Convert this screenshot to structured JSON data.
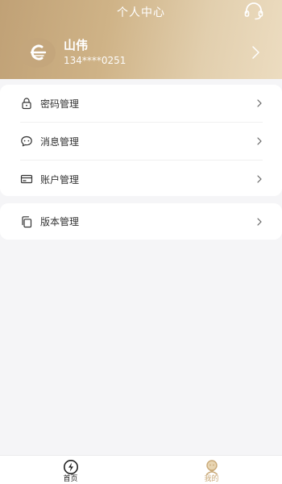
{
  "header": {
    "title": "个人中心",
    "service_icon": "headset-icon",
    "user": {
      "name": "山伟",
      "phone": "134****0251"
    }
  },
  "menu_group1": [
    {
      "icon": "lock-icon",
      "label": "密码管理"
    },
    {
      "icon": "message-icon",
      "label": "消息管理"
    },
    {
      "icon": "card-icon",
      "label": "账户管理"
    }
  ],
  "menu_group2": [
    {
      "icon": "copy-icon",
      "label": "版本管理"
    }
  ],
  "tabbar": {
    "tabs": [
      {
        "label": "首页",
        "icon": "lightning-icon",
        "active": false
      },
      {
        "label": "我的",
        "icon": "user-icon",
        "active": true
      }
    ]
  },
  "colors": {
    "header_gradient_start": "#c0a176",
    "header_gradient_end": "#ecdcc0",
    "active_tab": "#c9a978",
    "inactive_tab": "#222222"
  }
}
